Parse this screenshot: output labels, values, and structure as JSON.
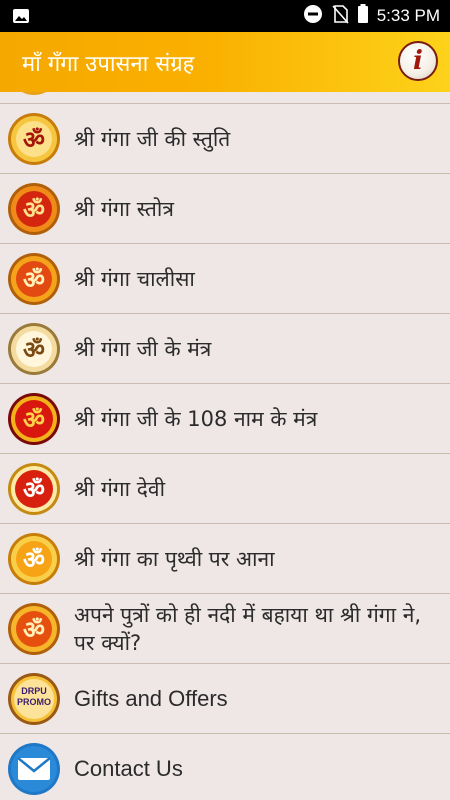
{
  "status": {
    "time": "5:33 PM"
  },
  "app": {
    "title": "माँ गँगा उपासना संग्रह",
    "info_symbol": "i"
  },
  "items": [
    {
      "label": "श्री गंगा जी की स्तुति",
      "icon": "om-icon"
    },
    {
      "label": "श्री गंगा स्तोत्र",
      "icon": "om-icon"
    },
    {
      "label": "श्री गंगा चालीसा",
      "icon": "om-icon"
    },
    {
      "label": "श्री गंगा जी के मंत्र",
      "icon": "om-icon"
    },
    {
      "label": "श्री गंगा जी के 108 नाम के मंत्र",
      "icon": "om-icon"
    },
    {
      "label": "श्री गंगा देवी",
      "icon": "om-icon"
    },
    {
      "label": "श्री गंगा का पृथ्वी पर आना",
      "icon": "om-icon"
    },
    {
      "label": "अपने पुत्रों को ही नदी में बहाया था श्री गंगा ने, पर क्यों?",
      "icon": "om-icon"
    },
    {
      "label": "Gifts and Offers",
      "icon": "drpu-promo-icon",
      "badge": "DRPU PROMO"
    },
    {
      "label": "Contact Us",
      "icon": "mail-icon"
    }
  ],
  "colors": {
    "app_bar": "#f7ad00",
    "row_bg": "#efe6e6",
    "divider": "#cbbcb0",
    "om_red": "#d4260f",
    "om_gold": "#f3b21a",
    "mail_blue": "#1f78c6"
  }
}
